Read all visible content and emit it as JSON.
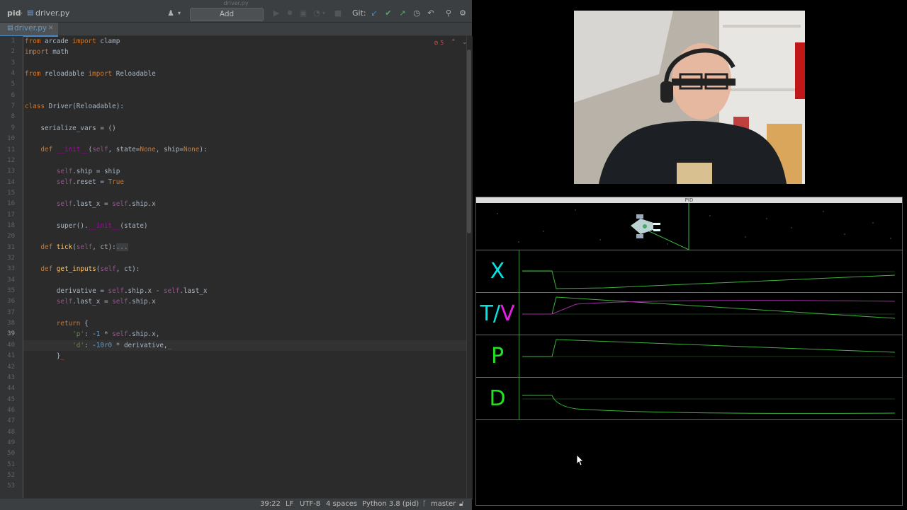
{
  "ide": {
    "window_title": "driver.py",
    "breadcrumb": {
      "project": "pid",
      "file": "driver.py"
    },
    "toolbar": {
      "add_configuration": "Add Configuration...",
      "git_label": "Git:"
    },
    "tab": {
      "label": "driver.py"
    },
    "inspection": {
      "count": "5"
    },
    "code": {
      "line_numbers": [
        "1",
        "2",
        "3",
        "4",
        "5",
        "6",
        "7",
        "8",
        "9",
        "10",
        "11",
        "12",
        "13",
        "14",
        "15",
        "16",
        "17",
        "18",
        "20",
        "31",
        "32",
        "33",
        "34",
        "35",
        "36",
        "37",
        "38",
        "39",
        "40",
        "41",
        "42",
        "43",
        "44",
        "45",
        "46",
        "47",
        "48",
        "49",
        "50",
        "51",
        "52",
        "53"
      ],
      "current_line": "39"
    },
    "status": {
      "position": "39:22",
      "line_sep": "LF",
      "encoding": "UTF-8",
      "indent": "4 spaces",
      "interpreter": "Python 3.8 (pid)",
      "branch": "master"
    }
  },
  "pid_window": {
    "title": "PID",
    "rows": [
      {
        "label": "X",
        "color": "#00e5e5"
      },
      {
        "label_a": "T/",
        "label_b": "V",
        "color_a": "#00e5e5",
        "color_b": "#e51ee5"
      },
      {
        "label": "P",
        "color": "#22e022"
      },
      {
        "label": "D",
        "color": "#22e022"
      }
    ]
  },
  "colors": {
    "ide_bg": "#2b2b2b",
    "plot_line": "#3cb43c",
    "velocity_line": "#a02ca0"
  }
}
